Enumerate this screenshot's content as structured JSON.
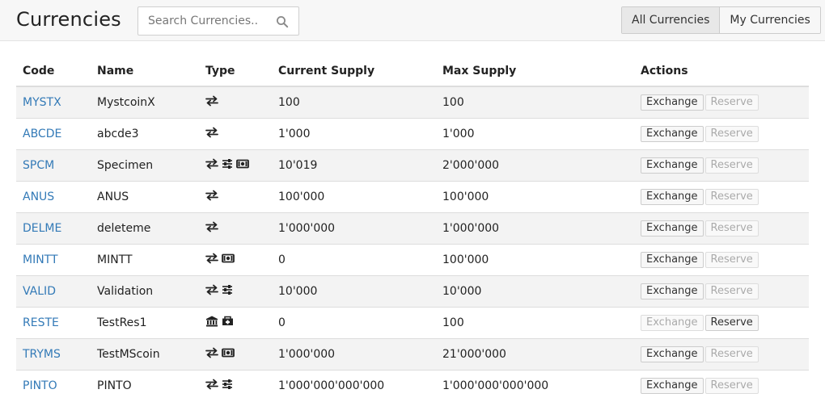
{
  "header": {
    "title": "Currencies",
    "search": {
      "placeholder": "Search Currencies..",
      "value": ""
    },
    "views": [
      {
        "label": "All Currencies",
        "active": true
      },
      {
        "label": "My Currencies",
        "active": false
      }
    ]
  },
  "table": {
    "columns": [
      "Code",
      "Name",
      "Type",
      "Current Supply",
      "Max Supply",
      "Actions"
    ],
    "actions": {
      "exchange_label": "Exchange",
      "reserve_label": "Reserve"
    },
    "rows": [
      {
        "code": "MYSTX",
        "name": "MystcoinX",
        "type_icons": [
          "exchange-icon"
        ],
        "current_supply": "100",
        "max_supply": "100",
        "exchange_enabled": true,
        "reserve_enabled": false
      },
      {
        "code": "ABCDE",
        "name": "abcde3",
        "type_icons": [
          "exchange-icon"
        ],
        "current_supply": "1'000",
        "max_supply": "1'000",
        "exchange_enabled": true,
        "reserve_enabled": false
      },
      {
        "code": "SPCM",
        "name": "Specimen",
        "type_icons": [
          "exchange-icon",
          "sliders-icon",
          "money-icon"
        ],
        "current_supply": "10'019",
        "max_supply": "2'000'000",
        "exchange_enabled": true,
        "reserve_enabled": false
      },
      {
        "code": "ANUS",
        "name": "ANUS",
        "type_icons": [
          "exchange-icon"
        ],
        "current_supply": "100'000",
        "max_supply": "100'000",
        "exchange_enabled": true,
        "reserve_enabled": false
      },
      {
        "code": "DELME",
        "name": "deleteme",
        "type_icons": [
          "exchange-icon"
        ],
        "current_supply": "1'000'000",
        "max_supply": "1'000'000",
        "exchange_enabled": true,
        "reserve_enabled": false
      },
      {
        "code": "MINTT",
        "name": "MINTT",
        "type_icons": [
          "exchange-icon",
          "money-icon"
        ],
        "current_supply": "0",
        "max_supply": "100'000",
        "exchange_enabled": true,
        "reserve_enabled": false
      },
      {
        "code": "VALID",
        "name": "Validation",
        "type_icons": [
          "exchange-icon",
          "sliders-icon"
        ],
        "current_supply": "10'000",
        "max_supply": "10'000",
        "exchange_enabled": true,
        "reserve_enabled": false
      },
      {
        "code": "RESTE",
        "name": "TestRes1",
        "type_icons": [
          "bank-icon",
          "reserve-icon"
        ],
        "current_supply": "0",
        "max_supply": "100",
        "exchange_enabled": false,
        "reserve_enabled": true
      },
      {
        "code": "TRYMS",
        "name": "TestMScoin",
        "type_icons": [
          "exchange-icon",
          "money-icon"
        ],
        "current_supply": "1'000'000",
        "max_supply": "21'000'000",
        "exchange_enabled": true,
        "reserve_enabled": false
      },
      {
        "code": "PINTO",
        "name": "PINTO",
        "type_icons": [
          "exchange-icon",
          "sliders-icon"
        ],
        "current_supply": "1'000'000'000'000",
        "max_supply": "1'000'000'000'000",
        "exchange_enabled": true,
        "reserve_enabled": false
      }
    ]
  },
  "colors": {
    "link": "#337ab7",
    "stripe": "#f3f3f3",
    "header_bg": "#f7f7f7"
  }
}
